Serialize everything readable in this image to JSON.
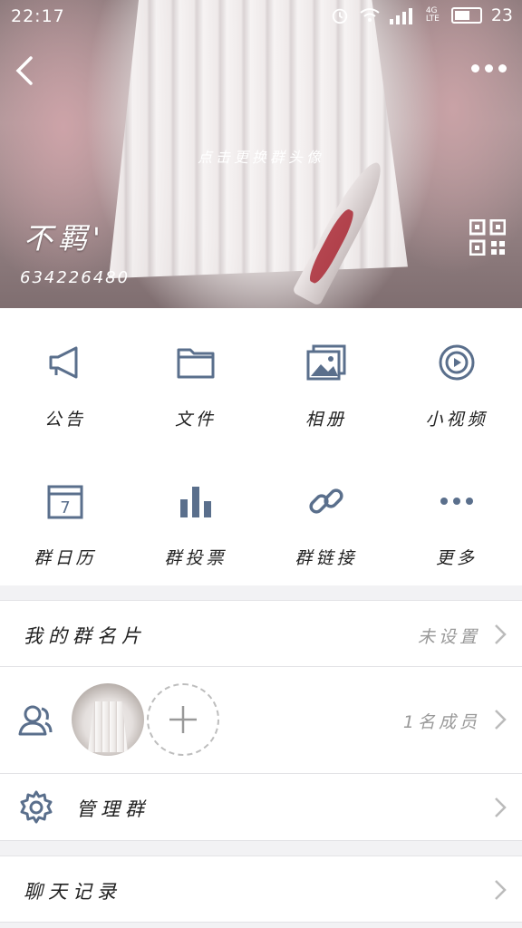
{
  "status_bar": {
    "time": "22:17",
    "network": "4G LTE",
    "battery_level": "23"
  },
  "header": {
    "change_avatar_hint": "点击更换群头像",
    "group_name": "不羁'",
    "group_id": "634226480"
  },
  "actions": [
    {
      "label": "公告",
      "icon": "megaphone-icon"
    },
    {
      "label": "文件",
      "icon": "folder-icon"
    },
    {
      "label": "相册",
      "icon": "album-icon"
    },
    {
      "label": "小视频",
      "icon": "video-icon"
    },
    {
      "label": "群日历",
      "icon": "calendar-icon"
    },
    {
      "label": "群投票",
      "icon": "poll-icon"
    },
    {
      "label": "群链接",
      "icon": "link-icon"
    },
    {
      "label": "更多",
      "icon": "more-icon"
    }
  ],
  "calendar_day": "7",
  "my_card": {
    "title": "我的群名片",
    "value": "未设置"
  },
  "members": {
    "count_text": "1名成员"
  },
  "manage": {
    "title": "管理群"
  },
  "chat_history": {
    "title": "聊天记录"
  },
  "colors": {
    "icon": "#5a6f8c",
    "accent": "#ffffff"
  }
}
